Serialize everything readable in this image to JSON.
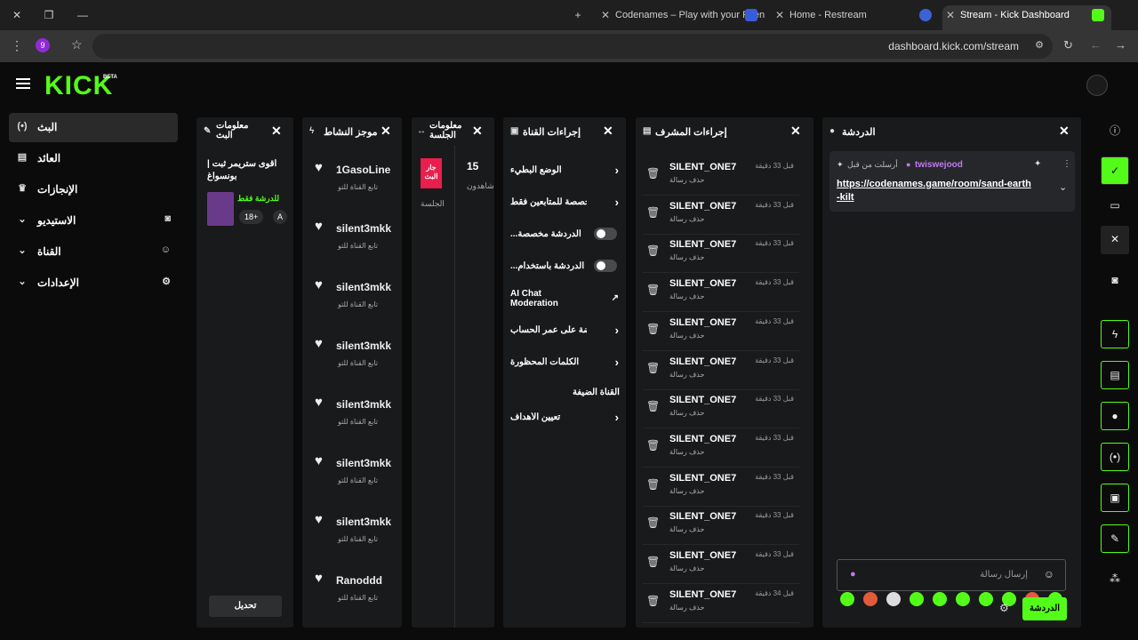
{
  "browser": {
    "tabs": [
      {
        "title": "Codenames – Play with your Frien"
      },
      {
        "title": "Home - Restream"
      },
      {
        "title": "Stream - Kick Dashboard"
      }
    ],
    "url": "dashboard.kick.com/stream",
    "profile_initial": "9"
  },
  "app": {
    "logo": "KICK",
    "beta": "BETA"
  },
  "nav": [
    {
      "label": "البث",
      "icon": "broadcast-icon"
    },
    {
      "label": "العائد",
      "icon": "revenue-icon"
    },
    {
      "label": "الإنجازات",
      "icon": "trophy-icon"
    },
    {
      "label": "الاستيديو",
      "icon": "studio-icon"
    },
    {
      "label": "القناة",
      "icon": "channel-icon"
    },
    {
      "label": "الإعدادات",
      "icon": "settings-icon"
    }
  ],
  "stream_info": {
    "title": "معلومات البث",
    "stream_title": "اقوى ستريمر ثبت | بونسواغ",
    "tag": "للدرشة فقط",
    "badge": "18+",
    "badge2": "A",
    "edit_button": "تحديل"
  },
  "activity": {
    "title": "موجز النشاط",
    "items": [
      {
        "name": "1GasoLine",
        "sub": "تابع القناة للتو"
      },
      {
        "name": "silent3mkk",
        "sub": "تابع القناة للتو"
      },
      {
        "name": "silent3mkk",
        "sub": "تابع القناة للتو"
      },
      {
        "name": "silent3mkk",
        "sub": "تابع القناة للتو"
      },
      {
        "name": "silent3mkk",
        "sub": "تابع القناة للتو"
      },
      {
        "name": "silent3mkk",
        "sub": "تابع القناة للتو"
      },
      {
        "name": "silent3mkk",
        "sub": "تابع القناة للتو"
      },
      {
        "name": "Ranoddd",
        "sub": "تابع القناة للتو"
      }
    ]
  },
  "session": {
    "title": "معلومات الجلسة",
    "live_badge": "جار البث",
    "label": "الجلسة",
    "viewers": "15",
    "viewers_label": "شاهدون"
  },
  "channel_actions": {
    "title": "إجراءات القناة",
    "rows": [
      {
        "label": "الوضع البطيء",
        "kind": "chevron"
      },
      {
        "label": "لة مخصصة للمتابعين فقط",
        "kind": "chevron"
      },
      {
        "label": "...الدردشة مخصصة",
        "kind": "toggle"
      },
      {
        "label": "...الدردشة باستخدام",
        "kind": "toggle"
      },
      {
        "label": "AI Chat Moderation",
        "kind": "external"
      },
      {
        "label": "فروضة على عمر الحساب",
        "kind": "chevron"
      },
      {
        "label": "الكلمات المحظورة",
        "kind": "chevron"
      },
      {
        "label": "القناة الضيفة",
        "kind": "none"
      },
      {
        "label": "تعيين الأهداف",
        "kind": "chevron"
      }
    ]
  },
  "mod_actions": {
    "title": "إجراءات المشرف",
    "rows": [
      {
        "user": "SILENT_ONE7",
        "action": "حذف رسالة",
        "time": "قبل 33 دقيقة"
      },
      {
        "user": "SILENT_ONE7",
        "action": "حذف رسالة",
        "time": "قبل 33 دقيقة"
      },
      {
        "user": "SILENT_ONE7",
        "action": "حذف رسالة",
        "time": "قبل 33 دقيقة"
      },
      {
        "user": "SILENT_ONE7",
        "action": "حذف رسالة",
        "time": "قبل 33 دقيقة"
      },
      {
        "user": "SILENT_ONE7",
        "action": "حذف رسالة",
        "time": "قبل 33 دقيقة"
      },
      {
        "user": "SILENT_ONE7",
        "action": "حذف رسالة",
        "time": "قبل 33 دقيقة"
      },
      {
        "user": "SILENT_ONE7",
        "action": "حذف رسالة",
        "time": "قبل 33 دقيقة"
      },
      {
        "user": "SILENT_ONE7",
        "action": "حذف رسالة",
        "time": "قبل 33 دقيقة"
      },
      {
        "user": "SILENT_ONE7",
        "action": "حذف رسالة",
        "time": "قبل 33 دقيقة"
      },
      {
        "user": "SILENT_ONE7",
        "action": "حذف رسالة",
        "time": "قبل 33 دقيقة"
      },
      {
        "user": "SILENT_ONE7",
        "action": "حذف رسالة",
        "time": "قبل 33 دقيقة"
      },
      {
        "user": "SILENT_ONE7",
        "action": "حذف رسالة",
        "time": "قبل 34 دقيقة"
      }
    ]
  },
  "chat": {
    "title": "الدردشة",
    "pinned_by": "أرسلت من قبل",
    "pinned_user": "twiswejood",
    "pinned_link": "https://codenames.game/room/sand-earth-kilt",
    "input_placeholder": "إرسال رسالة",
    "send_button": "الدردشة"
  },
  "colors": {
    "accent": "#53fc18",
    "live": "#e91e4d"
  }
}
